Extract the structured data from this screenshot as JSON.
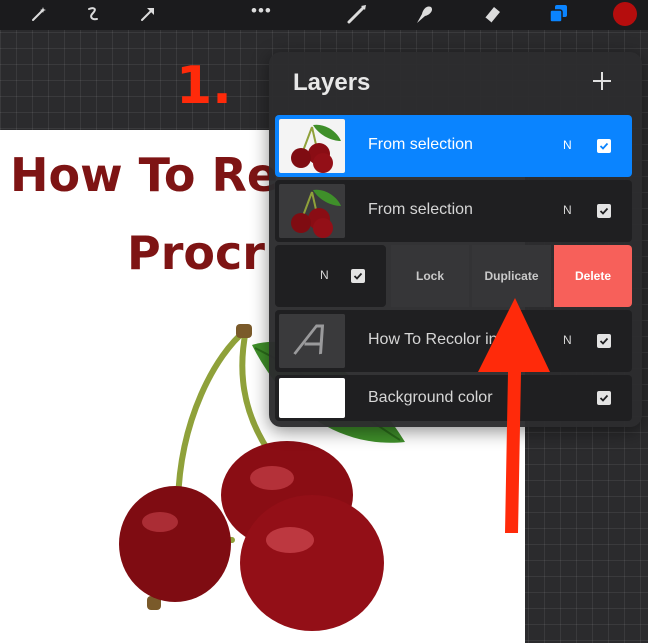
{
  "toolbar": {
    "more_label": "•••",
    "tools": [
      "magic-wand",
      "adjustments",
      "selection",
      "brush",
      "smudge",
      "eraser",
      "layers"
    ],
    "active_color": "#b50d0d",
    "accent_color": "#0a84ff"
  },
  "canvas": {
    "title_line_1": "How To Re",
    "title_line_2": "Procr"
  },
  "annotation": {
    "step": "1."
  },
  "layers": {
    "title": "Layers",
    "rows": [
      {
        "name": "From selection",
        "mode": "N",
        "visible": true,
        "selected": true
      },
      {
        "name": "From selection",
        "mode": "N",
        "visible": true,
        "selected": false
      },
      {
        "name": "",
        "mode": "N",
        "visible": true,
        "actions": [
          "Lock",
          "Duplicate",
          "Delete"
        ]
      },
      {
        "name": "How To Recolor in",
        "mode": "N",
        "visible": true,
        "selected": false
      },
      {
        "name": "Background color",
        "mode": "",
        "visible": true,
        "selected": false
      }
    ]
  },
  "colors": {
    "delete": "#f7605a",
    "arrow": "#ff2a0a",
    "title_text": "#7e1414"
  }
}
